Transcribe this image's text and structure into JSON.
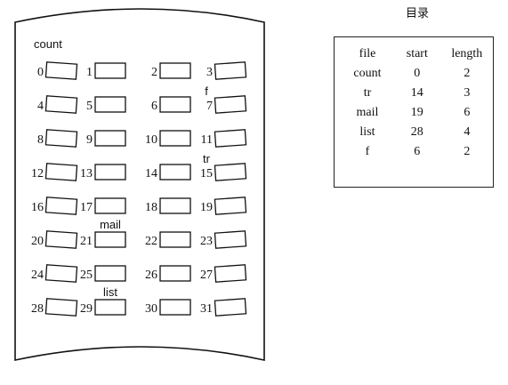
{
  "directory": {
    "title": "目录",
    "headers": [
      "file",
      "start",
      "length"
    ],
    "rows": [
      [
        "count",
        "0",
        "2"
      ],
      [
        "tr",
        "14",
        "3"
      ],
      [
        "mail",
        "19",
        "6"
      ],
      [
        "list",
        "28",
        "4"
      ],
      [
        "f",
        "6",
        "2"
      ]
    ]
  },
  "disk": {
    "blocks": [
      "0",
      "1",
      "2",
      "3",
      "4",
      "5",
      "6",
      "7",
      "8",
      "9",
      "10",
      "11",
      "12",
      "13",
      "14",
      "15",
      "16",
      "17",
      "18",
      "19",
      "20",
      "21",
      "22",
      "23",
      "24",
      "25",
      "26",
      "27",
      "28",
      "29",
      "30",
      "31"
    ],
    "file_labels": [
      {
        "text": "count",
        "block": 0
      },
      {
        "text": "f",
        "block": 7
      },
      {
        "text": "tr",
        "block": 15
      },
      {
        "text": "mail",
        "block": 21
      },
      {
        "text": "list",
        "block": 29
      }
    ]
  }
}
